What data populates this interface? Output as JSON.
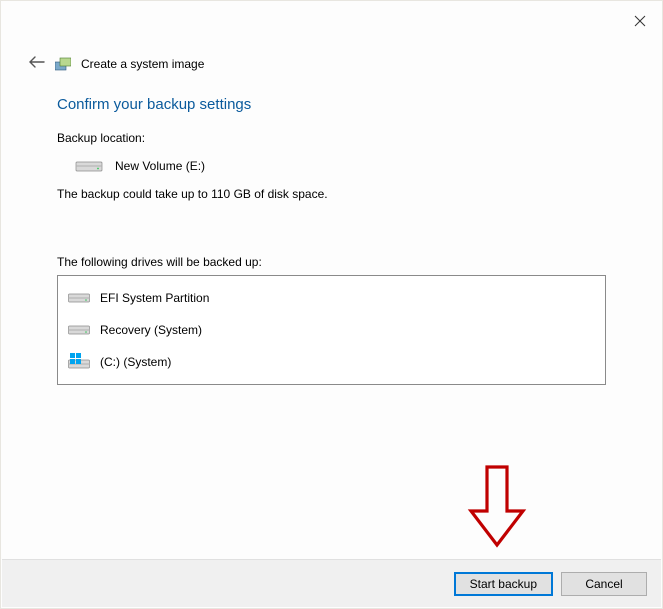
{
  "window": {
    "title": "Create a system image"
  },
  "heading": "Confirm your backup settings",
  "backup_location": {
    "label": "Backup location:",
    "value": "New Volume (E:)"
  },
  "space_info": "The backup could take up to 110 GB of disk space.",
  "drives": {
    "label": "The following drives will be backed up:",
    "items": [
      {
        "name": "EFI System Partition",
        "icon": "hdd"
      },
      {
        "name": "Recovery (System)",
        "icon": "hdd"
      },
      {
        "name": "(C:) (System)",
        "icon": "win"
      }
    ]
  },
  "buttons": {
    "start": "Start backup",
    "cancel": "Cancel"
  }
}
